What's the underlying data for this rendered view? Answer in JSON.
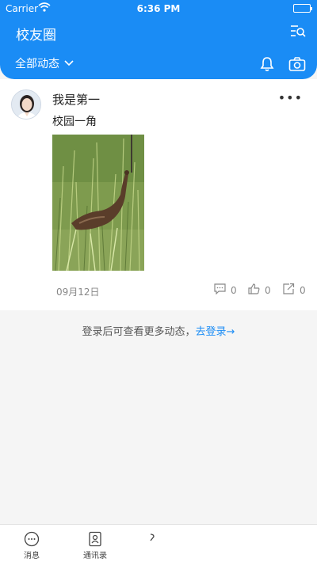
{
  "status_bar": {
    "carrier": "Carrier",
    "time": "6:36 PM"
  },
  "header": {
    "title": "校友圈",
    "filter_label": "全部动态"
  },
  "icons": {
    "wifi": "wifi-icon",
    "battery": "battery-icon",
    "search_list": "search-list-icon",
    "dropdown": "chevron-down-icon",
    "bell": "bell-icon",
    "camera": "camera-icon",
    "more": "more-icon",
    "comment": "comment-icon",
    "like": "thumbs-up-icon",
    "share": "share-icon"
  },
  "post": {
    "author": "我是第一",
    "content": "校园一角",
    "date": "09月12日",
    "more_symbol": "•••",
    "comments": "0",
    "likes": "0",
    "shares": "0"
  },
  "login_prompt": {
    "text": "登录后可查看更多动态，",
    "link": "去登录→"
  },
  "tabbar": {
    "tabs": [
      {
        "label": "消息"
      },
      {
        "label": "通讯录"
      }
    ]
  },
  "colors": {
    "accent": "#1a8cf5",
    "background": "#f5f5f5"
  }
}
